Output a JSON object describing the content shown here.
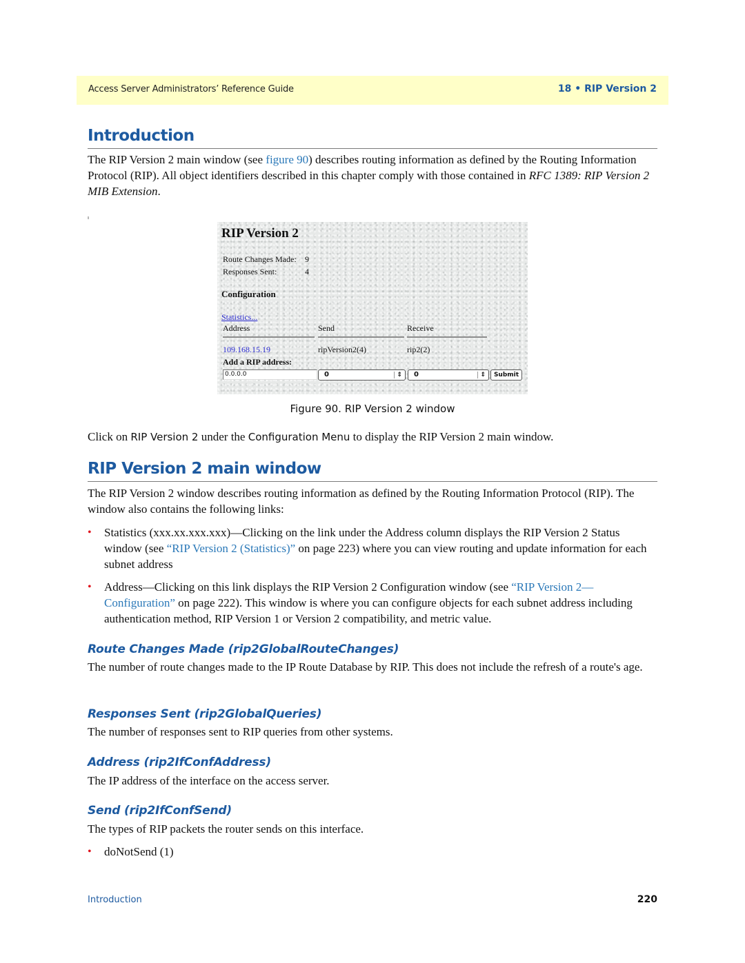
{
  "header": {
    "guide_title": "Access Server Administrators’ Reference Guide",
    "chapter": "18 • RIP Version 2"
  },
  "introduction": {
    "heading": "Introduction",
    "para_part1": "The RIP Version 2 main window (see ",
    "para_link": "figure 90",
    "para_part2": ") describes routing information as defined by the Routing Information Protocol (RIP). All object identifiers described in this chapter comply with those contained in ",
    "para_italic": "RFC 1389: RIP Version 2 MIB Extension",
    "para_end": "."
  },
  "figure": {
    "title": "RIP Version 2",
    "stats": [
      {
        "label": "Route Changes Made:",
        "value": "9"
      },
      {
        "label": "Responses Sent:",
        "value": "4"
      }
    ],
    "config_heading": "Configuration",
    "statistics_link": "Statistics...",
    "columns": [
      "Address",
      "Send",
      "Receive"
    ],
    "row": {
      "address": "109.168.15.19",
      "send": "ripVersion2(4)",
      "receive": "rip2(2)"
    },
    "add_label": "Add a RIP address:",
    "address_input_value": "0.0.0.0",
    "send_select_value": "0",
    "receive_select_value": "0",
    "submit_label": "Submit",
    "select_arrow_icon": "⇕",
    "caption": "Figure 90. RIP Version 2 window"
  },
  "click_para": {
    "part1": "Click on ",
    "ui1": "RIP Version 2",
    "part2": " under the ",
    "ui2": "Configuration Menu",
    "part3": " to display the RIP Version 2 main window."
  },
  "main_window": {
    "heading": "RIP Version 2 main window",
    "para": "The RIP Version 2 window describes routing information as defined by the Routing Information Protocol (RIP). The window also contains the following links:",
    "bullets": [
      {
        "text1": "Statistics (xxx.xx.xxx.xxx)—Clicking on the link under the Address column displays the RIP Version 2 Status window (see ",
        "link": "“RIP Version 2 (Statistics)”",
        "text2": " on page 223) where you can view routing and update information for each subnet address"
      },
      {
        "text1": "Address—Clicking on this link displays the RIP Version 2 Configuration window (see ",
        "link": "“RIP Version 2—Configuration”",
        "text2": " on page 222). This window is where you can configure objects for each subnet address including authentication method, RIP Version 1 or Version 2 compatibility, and metric value."
      }
    ]
  },
  "sections": [
    {
      "heading": "Route Changes Made (rip2GlobalRouteChanges)",
      "text": "The number of route changes made to the IP Route Database by RIP. This does not include the refresh of a route's age."
    },
    {
      "heading": "Responses Sent (rip2GlobalQueries)",
      "text": "The number of responses sent to RIP queries from other systems."
    },
    {
      "heading": "Address (rip2IfConfAddress)",
      "text": "The IP address of the interface on the access server."
    },
    {
      "heading": "Send (rip2IfConfSend)",
      "text": "The types of RIP packets the router sends on this interface."
    }
  ],
  "send_values": [
    "doNotSend (1)"
  ],
  "bullet_icon": "•",
  "footer": {
    "section": "Introduction",
    "page_number": "220"
  }
}
